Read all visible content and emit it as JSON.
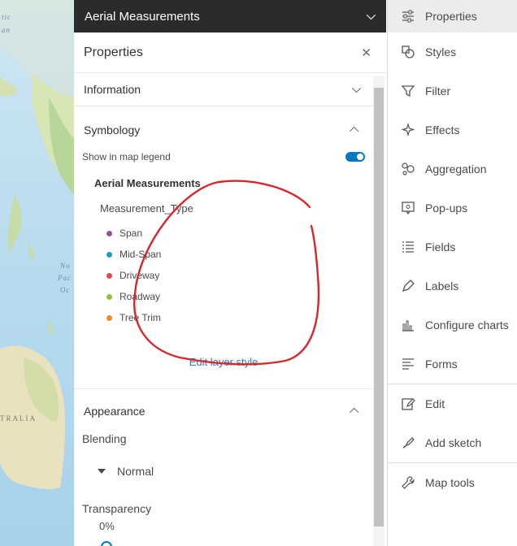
{
  "map": {
    "labels": {
      "ocean_top": "tic",
      "ocean_top2": "an",
      "ocean_mid1": "No",
      "ocean_mid2": "Pac",
      "ocean_mid3": "Oc",
      "land_bottom": "TRALIA"
    }
  },
  "layer_header": {
    "title": "Aerial Measurements"
  },
  "panel": {
    "title": "Properties"
  },
  "sections": {
    "information": {
      "label": "Information"
    },
    "symbology": {
      "label": "Symbology",
      "show_in_legend_label": "Show in map legend",
      "show_in_legend_enabled": true,
      "legend_layer_title": "Aerial Measurements",
      "legend_field": "Measurement_Type",
      "legend_items": [
        {
          "label": "Span",
          "color": "#9b4f96"
        },
        {
          "label": "Mid-Span",
          "color": "#1f9ac6"
        },
        {
          "label": "Driveway",
          "color": "#e04a4a"
        },
        {
          "label": "Roadway",
          "color": "#92c13f"
        },
        {
          "label": "Tree Trim",
          "color": "#ef8a2e"
        }
      ],
      "edit_style_link": "Edit layer style"
    },
    "appearance": {
      "label": "Appearance",
      "blending_label": "Blending",
      "blending_value": "Normal",
      "transparency_label": "Transparency",
      "transparency_value": "0%"
    }
  },
  "toolbar": {
    "items": [
      {
        "label": "Properties",
        "icon": "sliders-icon",
        "active": true
      },
      {
        "label": "Styles",
        "icon": "shapes-icon"
      },
      {
        "label": "Filter",
        "icon": "filter-icon"
      },
      {
        "label": "Effects",
        "icon": "sparkle-icon"
      },
      {
        "label": "Aggregation",
        "icon": "aggregation-icon"
      },
      {
        "label": "Pop-ups",
        "icon": "popup-icon"
      },
      {
        "label": "Fields",
        "icon": "list-icon"
      },
      {
        "label": "Labels",
        "icon": "label-tag-icon"
      },
      {
        "label": "Configure charts",
        "icon": "chart-icon"
      },
      {
        "label": "Forms",
        "icon": "form-icon"
      },
      {
        "label": "Edit",
        "icon": "pencil-square-icon"
      },
      {
        "label": "Add sketch",
        "icon": "sketch-pen-icon"
      },
      {
        "label": "Map tools",
        "icon": "wrench-icon"
      }
    ]
  },
  "colors": {
    "accent": "#0079c1",
    "link": "#2f7bbd",
    "header_bg": "#2b2b2b",
    "annotation": "#d9262a"
  }
}
